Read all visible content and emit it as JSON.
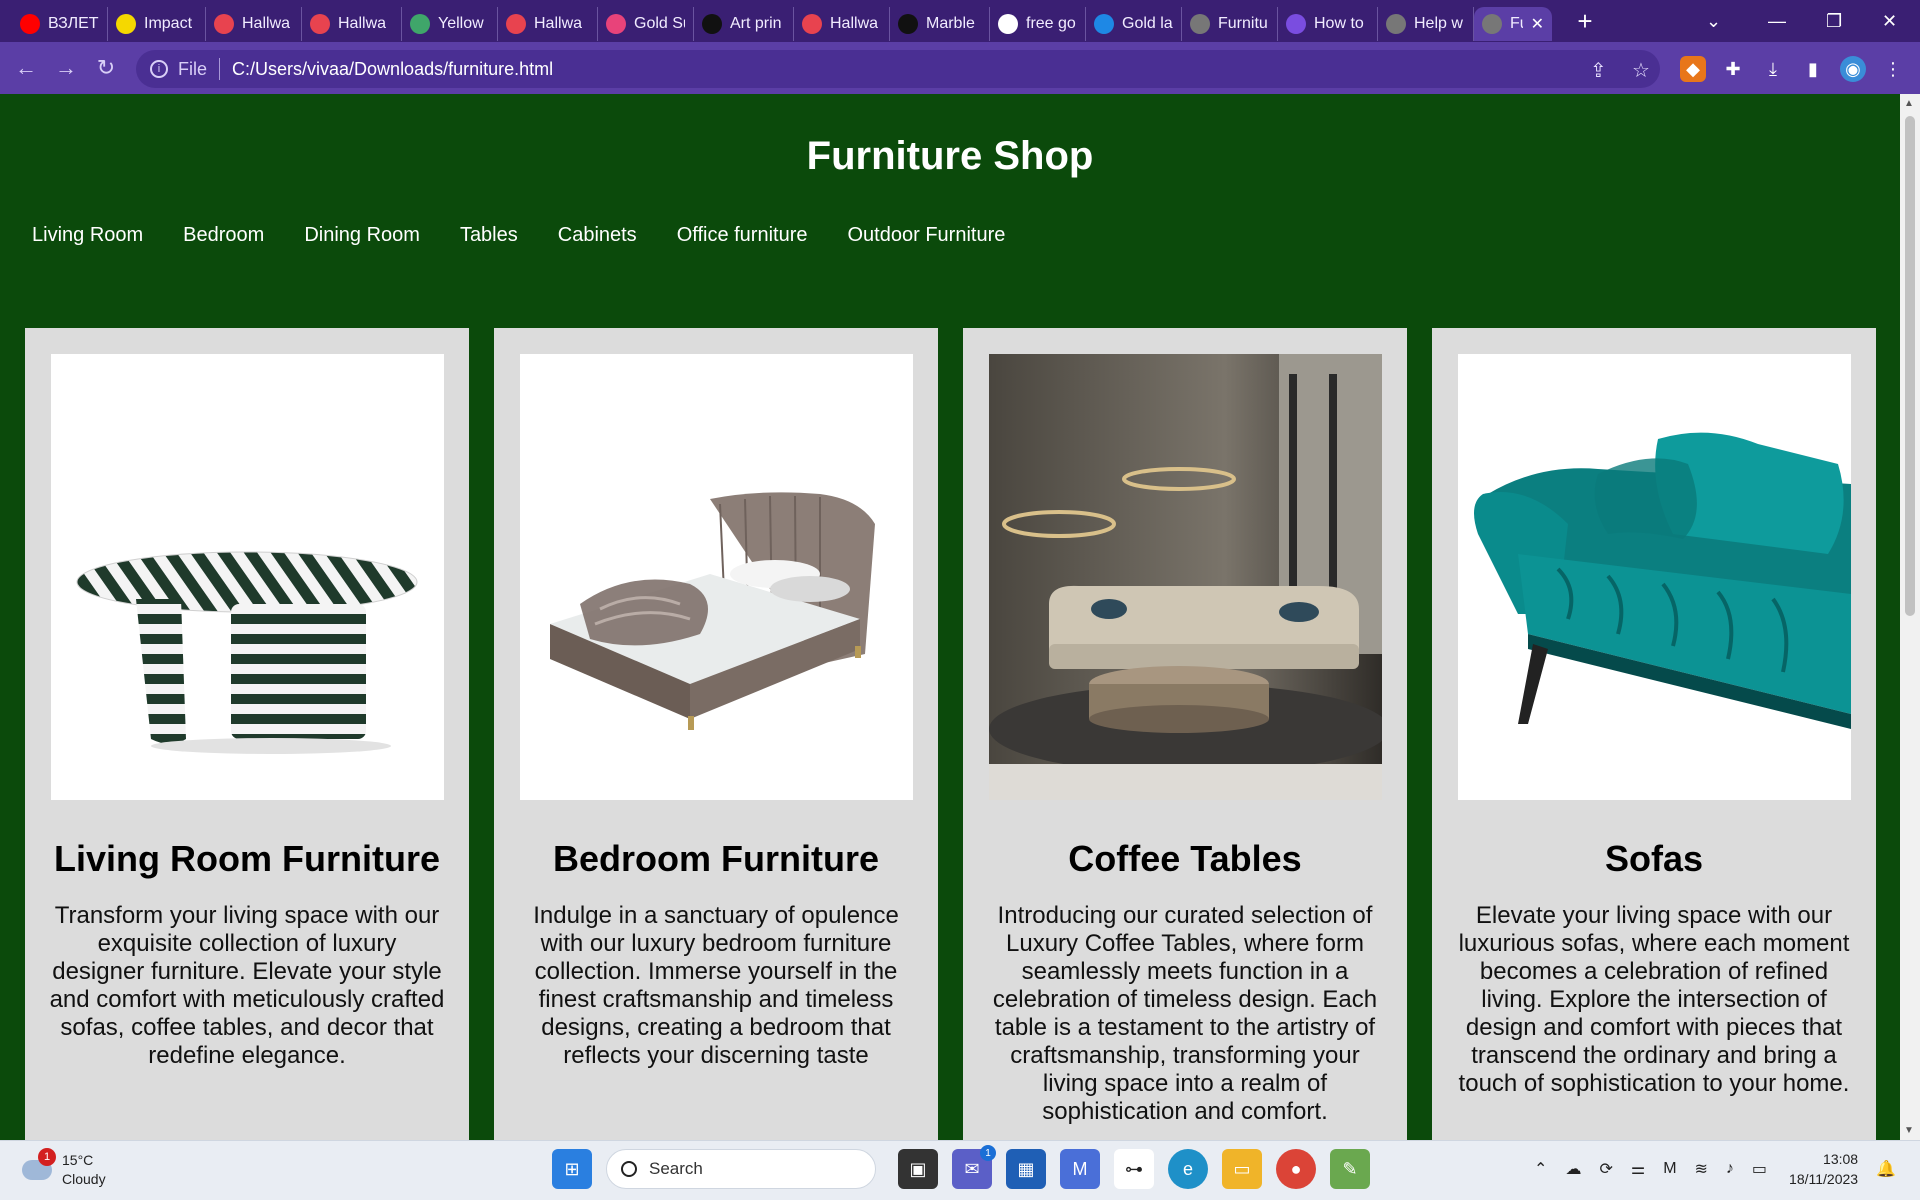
{
  "browser": {
    "tabs": [
      {
        "label": "ВЗЛЕТ",
        "icon": "youtube-icon",
        "color": "#ff0000"
      },
      {
        "label": "Impact",
        "icon": "impact-icon",
        "color": "#f5d800"
      },
      {
        "label": "Hallwa",
        "icon": "hallway-icon",
        "color": "#e8434f"
      },
      {
        "label": "Hallwa",
        "icon": "hallway-icon",
        "color": "#e8434f"
      },
      {
        "label": "Yellow",
        "icon": "yellow-icon",
        "color": "#3fa66a"
      },
      {
        "label": "Hallwa",
        "icon": "hallway-icon",
        "color": "#e8434f"
      },
      {
        "label": "Gold Su",
        "icon": "gold-icon",
        "color": "#e8437a"
      },
      {
        "label": "Art prin",
        "icon": "amazon-icon",
        "color": "#111111"
      },
      {
        "label": "Hallwa",
        "icon": "hallway-icon",
        "color": "#e8434f"
      },
      {
        "label": "Marble",
        "icon": "st-icon",
        "color": "#111111"
      },
      {
        "label": "free go",
        "icon": "google-icon",
        "color": "#ffffff"
      },
      {
        "label": "Gold la",
        "icon": "vector-icon",
        "color": "#1e88e5"
      },
      {
        "label": "Furnitu",
        "icon": "globe-icon",
        "color": "#777777"
      },
      {
        "label": "How to",
        "icon": "how-icon",
        "color": "#7a4de0"
      },
      {
        "label": "Help w",
        "icon": "globe-icon",
        "color": "#777777"
      },
      {
        "label": "Fur",
        "icon": "globe-icon",
        "color": "#777777",
        "active": true
      }
    ],
    "address": {
      "scheme": "File",
      "url": "C:/Users/vivaa/Downloads/furniture.html"
    }
  },
  "site": {
    "title": "Furniture Shop",
    "nav": [
      "Living Room",
      "Bedroom",
      "Dining Room",
      "Tables",
      "Cabinets",
      "Office furniture",
      "Outdoor Furniture"
    ],
    "cards": [
      {
        "title": "Living Room Furniture",
        "text": "Transform your living space with our exquisite collection of luxury designer furniture. Elevate your style and comfort with meticulously crafted sofas, coffee tables, and decor that redefine elegance.",
        "image": "striped-marble-table"
      },
      {
        "title": "Bedroom Furniture",
        "text": "Indulge in a sanctuary of opulence with our luxury bedroom furniture collection. Immerse yourself in the finest craftsmanship and timeless designs, creating a bedroom that reflects your discerning taste",
        "image": "upholstered-bed"
      },
      {
        "title": "Coffee Tables",
        "text": "Introducing our curated selection of Luxury Coffee Tables, where form seamlessly meets function in a celebration of timeless design. Each table is a testament to the artistry of craftsmanship, transforming your living space into a realm of sophistication and comfort.",
        "image": "living-room-coffee-table"
      },
      {
        "title": "Sofas",
        "text": "Elevate your living space with our luxurious sofas, where each moment becomes a celebration of refined living. Explore the intersection of design and comfort with pieces that transcend the ordinary and bring a touch of sophistication to your home.",
        "image": "teal-velvet-sofa"
      }
    ]
  },
  "taskbar": {
    "weather": {
      "temp": "15°C",
      "condition": "Cloudy",
      "badge": "1"
    },
    "search_label": "Search",
    "chat_badge": "1",
    "clock": {
      "time": "13:08",
      "date": "18/11/2023"
    }
  },
  "colors": {
    "page_bg": "#0b4a0b",
    "card_bg": "#dcdcdc",
    "tabbar_bg": "#3a1f73",
    "toolbar_bg": "#5b3ea6"
  }
}
